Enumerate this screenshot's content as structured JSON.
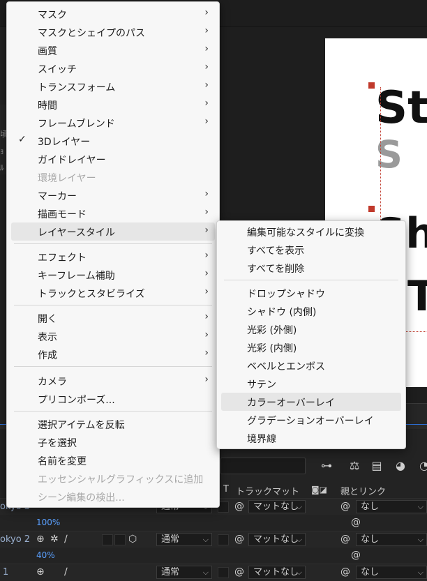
{
  "main_menu": {
    "items": [
      {
        "label": "マスク",
        "submenu": true
      },
      {
        "label": "マスクとシェイプのパス",
        "submenu": true
      },
      {
        "label": "画質",
        "submenu": true
      },
      {
        "label": "スイッチ",
        "submenu": true
      },
      {
        "label": "トランスフォーム",
        "submenu": true
      },
      {
        "label": "時間",
        "submenu": true
      },
      {
        "label": "フレームブレンド",
        "submenu": true
      },
      {
        "label": "3Dレイヤー",
        "checked": true
      },
      {
        "label": "ガイドレイヤー"
      },
      {
        "label": "環境レイヤー",
        "disabled": true
      },
      {
        "label": "マーカー",
        "submenu": true
      },
      {
        "label": "描画モード",
        "submenu": true
      },
      {
        "label": "レイヤースタイル",
        "submenu": true,
        "highlighted": true
      },
      {
        "label": "エフェクト",
        "submenu": true
      },
      {
        "label": "キーフレーム補助",
        "submenu": true
      },
      {
        "label": "トラックとスタビライズ",
        "submenu": true
      },
      {
        "label": "開く",
        "submenu": true
      },
      {
        "label": "表示",
        "submenu": true
      },
      {
        "label": "作成",
        "submenu": true
      },
      {
        "label": "カメラ",
        "submenu": true
      },
      {
        "label": "プリコンポーズ..."
      },
      {
        "label": "選択アイテムを反転"
      },
      {
        "label": "子を選択"
      },
      {
        "label": "名前を変更"
      },
      {
        "label": "エッセンシャルグラフィックスに追加",
        "disabled": true
      },
      {
        "label": "シーン編集の検出...",
        "disabled": true
      }
    ],
    "check_glyph": "✓",
    "arrow_glyph": "›"
  },
  "layer_style_submenu": {
    "items": [
      {
        "label": "編集可能なスタイルに変換"
      },
      {
        "label": "すべてを表示"
      },
      {
        "label": "すべてを削除"
      },
      {
        "label": "ドロップシャドウ"
      },
      {
        "label": "シャドウ (内側)"
      },
      {
        "label": "光彩 (外側)"
      },
      {
        "label": "光彩 (内側)"
      },
      {
        "label": "ベベルとエンボス"
      },
      {
        "label": "サテン"
      },
      {
        "label": "カラーオーバーレイ",
        "highlighted": true
      },
      {
        "label": "グラデーションオーバーレイ"
      },
      {
        "label": "境界線"
      }
    ]
  },
  "canvas": {
    "line1": "St",
    "line1_shadow": "S",
    "line2": "Sh",
    "line3": "T"
  },
  "left_panel_fragments": [
    "頃",
    "ｮ",
    "ﾙ"
  ],
  "timeline": {
    "columns": {
      "t_label": "T",
      "track_matte": "トラックマット",
      "parent_link": "親とリンク"
    },
    "rows": [
      {
        "name": "okyo 3",
        "mode": "通常",
        "matte": "マットなし",
        "parent": "なし",
        "opacity": "100%"
      },
      {
        "name": "okyo 2",
        "mode": "通常",
        "matte": "マットなし",
        "parent": "なし",
        "opacity": "40%"
      },
      {
        "name": "1",
        "mode": "通常",
        "matte": "マットなし",
        "parent": "なし"
      }
    ]
  },
  "colors": {
    "menu_bg": "#f7f7f7",
    "menu_highlight": "#e6e6e6",
    "disabled_text": "#a8a8a8",
    "selection_red": "#c0392b",
    "timeline_blue": "#5aa0ff"
  }
}
